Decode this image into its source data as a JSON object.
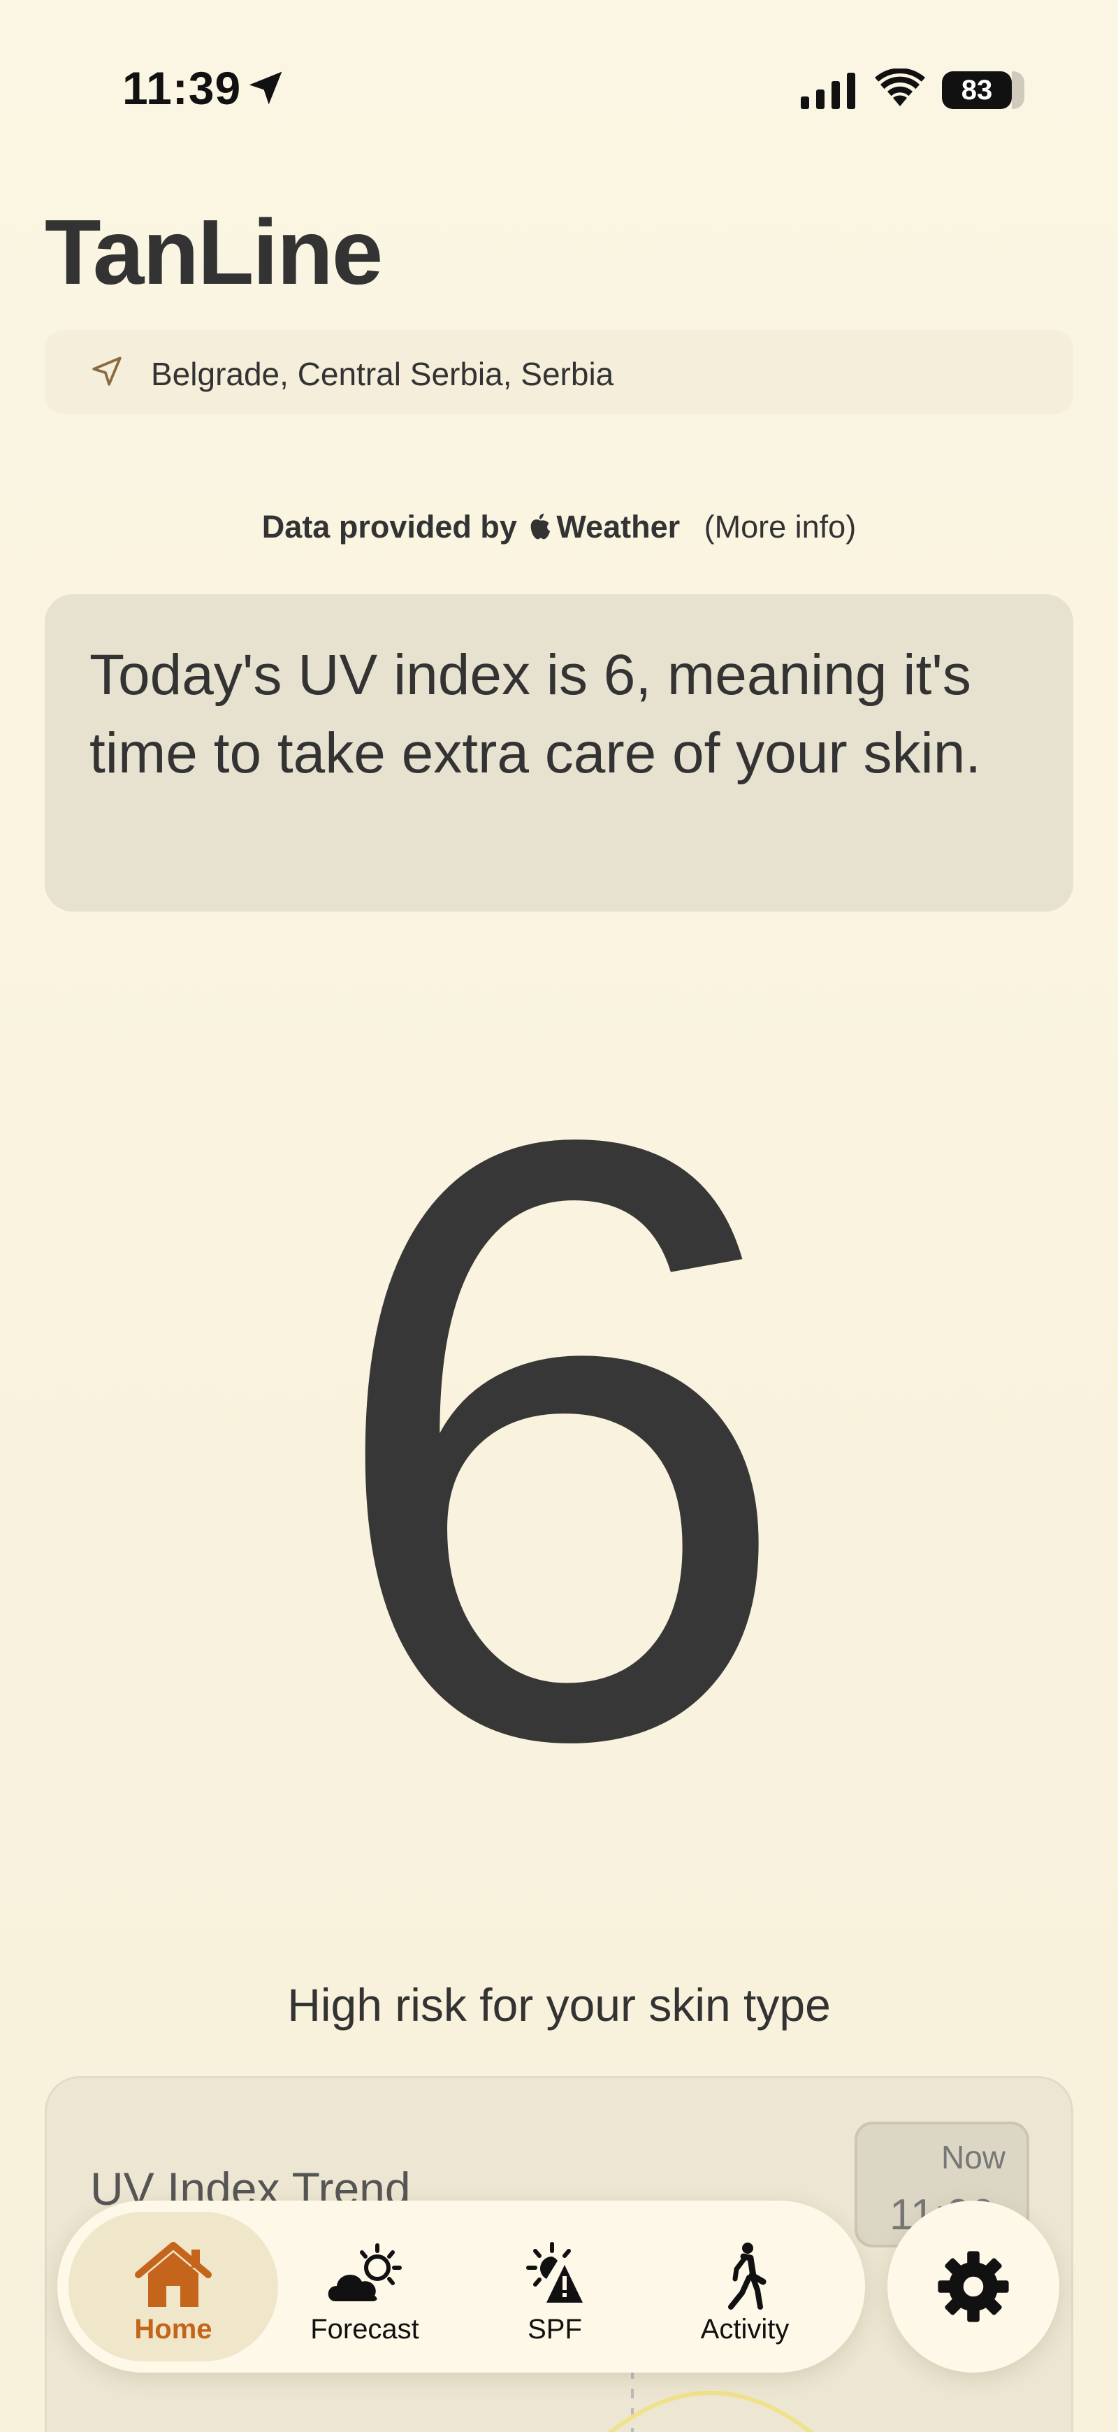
{
  "status_bar": {
    "time": "11:39",
    "battery": "83"
  },
  "header": {
    "title": "TanLine"
  },
  "location": {
    "text": "Belgrade, Central Serbia, Serbia"
  },
  "attribution": {
    "prefix": "Data provided by",
    "provider": "Weather",
    "more_info": "(More info)"
  },
  "uv": {
    "message": "Today's UV index is 6, meaning it's time to take extra care of your skin.",
    "value": "6",
    "risk": "High risk for your skin type"
  },
  "trend": {
    "title": "UV Index Trend",
    "now_label": "Now",
    "now_time": "11:00"
  },
  "tab_bar": {
    "tabs": [
      {
        "label": "Home",
        "icon": "house-icon",
        "active": true
      },
      {
        "label": "Forecast",
        "icon": "cloud-sun-icon",
        "active": false
      },
      {
        "label": "SPF",
        "icon": "sun-warning-icon",
        "active": false
      },
      {
        "label": "Activity",
        "icon": "walking-figure-icon",
        "active": false
      }
    ],
    "settings_icon": "gear-icon"
  },
  "colors": {
    "background": "#faf5e2",
    "accent": "#c4651b",
    "text": "#333333",
    "card": "#e7e2cf"
  }
}
